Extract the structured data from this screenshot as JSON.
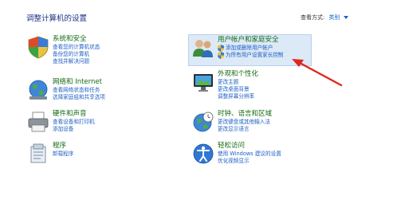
{
  "page_title": "调整计算机的设置",
  "view_by": {
    "label": "查看方式:",
    "value": "类别"
  },
  "categories": [
    {
      "title": "系统和安全",
      "icon": "shield-flag-icon",
      "links": [
        "查看您的计算机状态",
        "备份您的计算机",
        "查找并解决问题"
      ]
    },
    {
      "title": "网络和 Internet",
      "icon": "network-globe-icon",
      "links": [
        "查看网络状态和任务",
        "选择家庭组和共享选项"
      ]
    },
    {
      "title": "硬件和声音",
      "icon": "printer-icon",
      "links": [
        "查看设备和打印机",
        "添加设备"
      ]
    },
    {
      "title": "程序",
      "icon": "programs-icon",
      "links": [
        "卸载程序"
      ]
    },
    {
      "title": "用户帐户和家庭安全",
      "icon": "users-icon",
      "links": [
        "添加或删除用户帐户",
        "为所有用户设置家长控制"
      ],
      "link_shields": [
        true,
        true
      ]
    },
    {
      "title": "外观和个性化",
      "icon": "display-icon",
      "links": [
        "更改主题",
        "更改桌面背景",
        "调整屏幕分辨率"
      ]
    },
    {
      "title": "时钟、语言和区域",
      "icon": "clock-globe-icon",
      "links": [
        "更改键盘或其他输入法",
        "更改显示语言"
      ]
    },
    {
      "title": "轻松访问",
      "icon": "ease-of-access-icon",
      "links": [
        "使用 Windows 建议的设置",
        "优化视频显示"
      ]
    }
  ],
  "colors": {
    "heading": "#156a12",
    "link": "#1d5fc4",
    "title": "#1e3287",
    "arrow": "#e0261c",
    "highlight": "#dce9f7"
  }
}
